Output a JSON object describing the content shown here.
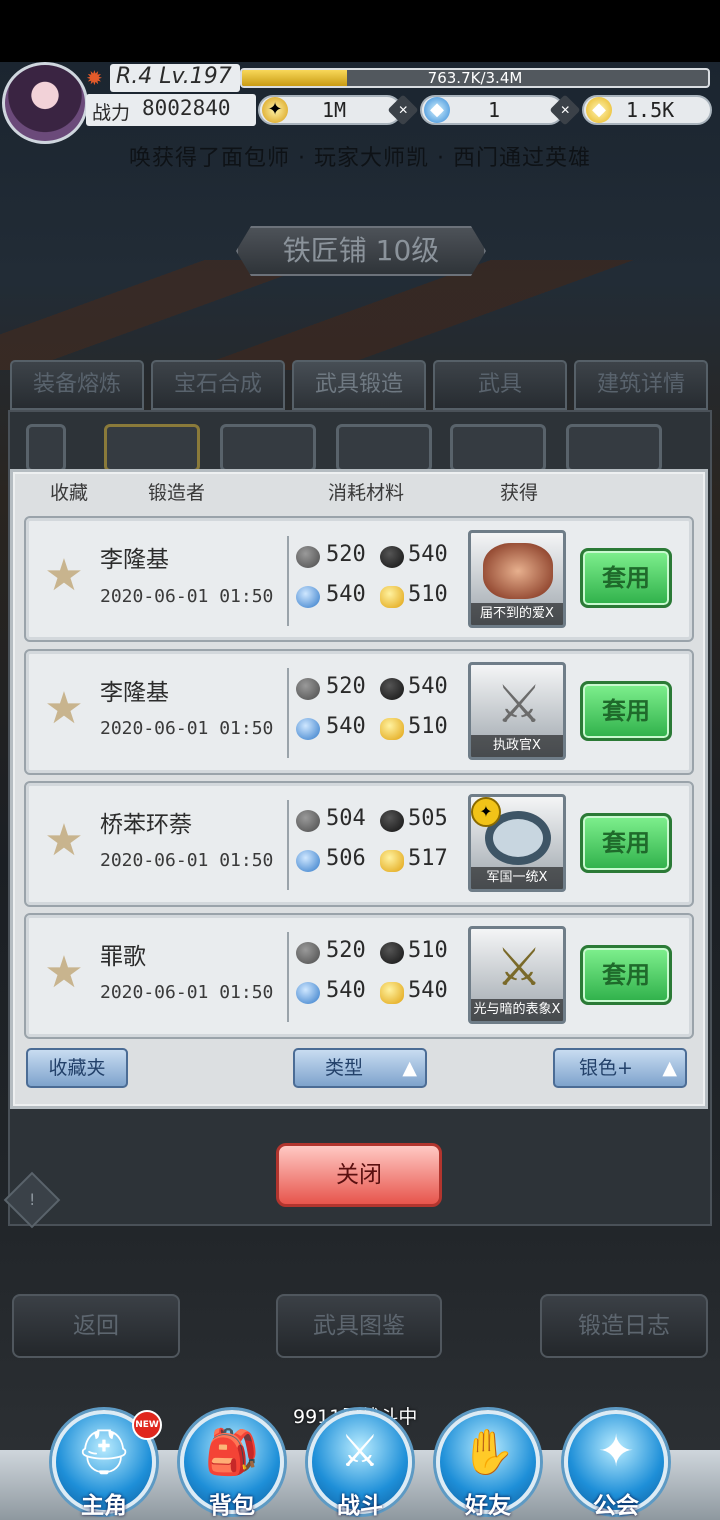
{
  "header": {
    "level": "R.4 Lv.197",
    "exp_text": "763.7K/3.4M",
    "exp_progress": 0.225,
    "power_label": "战力",
    "power_value": "8002840",
    "currencies": [
      {
        "icon": "gold-coin-icon",
        "value": "1M"
      },
      {
        "icon": "blue-diamond-icon",
        "value": "1"
      },
      {
        "icon": "gold-gem-icon",
        "value": "1.5K"
      }
    ]
  },
  "ticker": "唤获得了面包师 · 玩家大师凯 · 西门通过英雄",
  "building_title": "铁匠铺 10级",
  "tabs": [
    "装备熔炼",
    "宝石合成",
    "武具锻造",
    "武具",
    "建筑详情"
  ],
  "active_tab": "武具锻造",
  "modal": {
    "headers": {
      "favorite": "收藏",
      "smith": "锻造者",
      "materials": "消耗材料",
      "obtain": "获得"
    },
    "rows": [
      {
        "smith": "李隆基",
        "date": "2020-06-01 01:50",
        "stone": "520",
        "coal": "540",
        "crystal": "540",
        "gold": "510",
        "item": "届不到的爱X",
        "equip": "套用"
      },
      {
        "smith": "李隆基",
        "date": "2020-06-01 01:50",
        "stone": "520",
        "coal": "540",
        "crystal": "540",
        "gold": "510",
        "item": "执政官X",
        "equip": "套用"
      },
      {
        "smith": "桥苯环萘",
        "date": "2020-06-01 01:50",
        "stone": "504",
        "coal": "505",
        "crystal": "506",
        "gold": "517",
        "item": "军国一统X",
        "equip": "套用"
      },
      {
        "smith": "罪歌",
        "date": "2020-06-01 01:50",
        "stone": "520",
        "coal": "510",
        "crystal": "540",
        "gold": "540",
        "item": "光与暗的表象X",
        "equip": "套用"
      }
    ],
    "filters": {
      "favorites": "收藏夹",
      "type": "类型",
      "quality": "银色+"
    },
    "close": "关闭"
  },
  "bottom_buttons": {
    "back": "返回",
    "catalog": "武具图鉴",
    "log": "锻造日志"
  },
  "battle_status": "9911层战斗中",
  "nav": {
    "items": [
      "主角",
      "背包",
      "战斗",
      "好友",
      "公会"
    ],
    "new_badge": "NEW"
  }
}
